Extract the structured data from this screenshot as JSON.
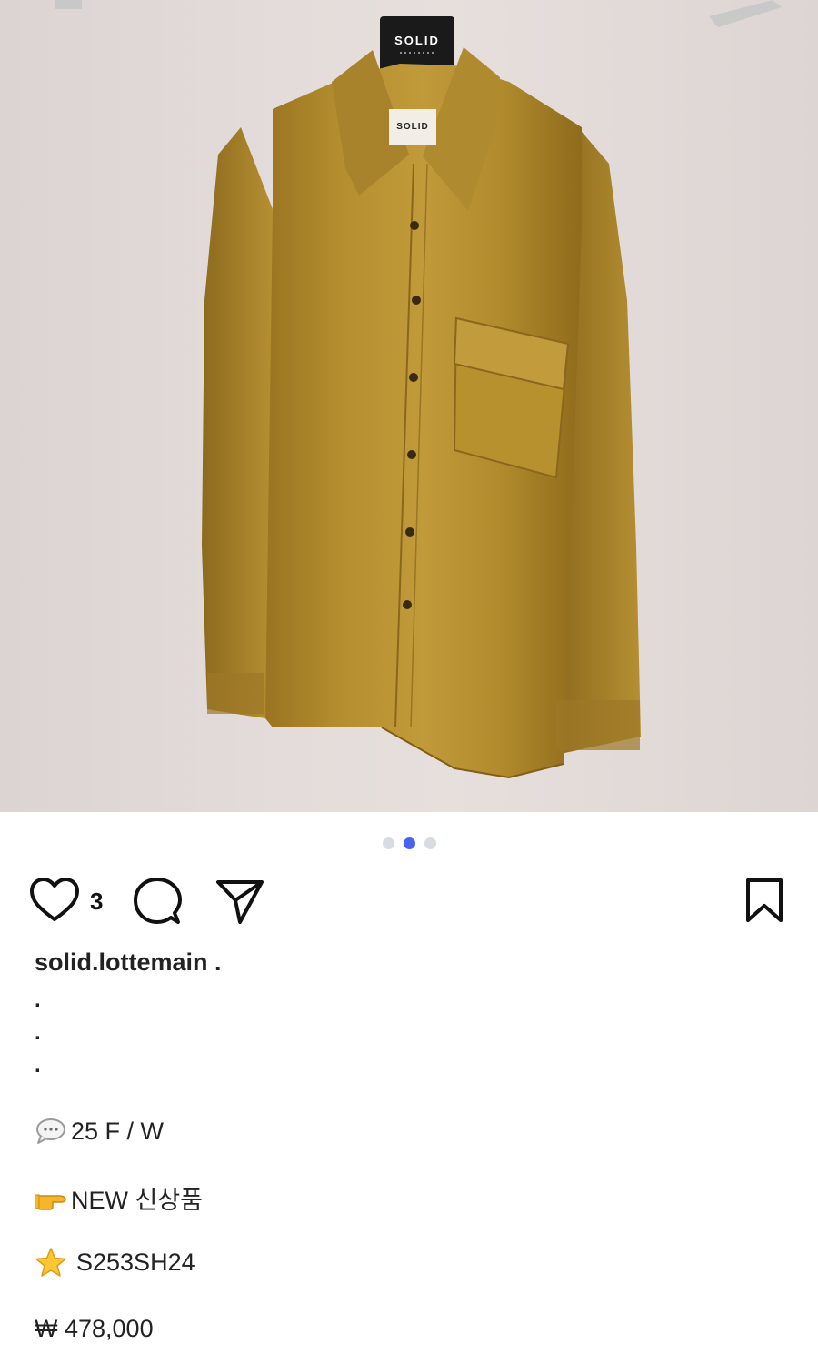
{
  "post": {
    "image": {
      "hanger_brand": "SOLID",
      "label_brand": "SOLID",
      "carousel_total": 3,
      "carousel_active_index": 1
    },
    "actions": {
      "like_count": "3"
    },
    "username": "solid.lottemain .",
    "caption": {
      "dots": [
        ".",
        ".",
        "."
      ],
      "season_emoji": "speech-bubble-icon",
      "season": "25 F / W",
      "new_emoji": "pointing-hand-icon",
      "new_label": "NEW 신상품",
      "code_emoji": "star-icon",
      "code": "S253SH24",
      "price": "₩ 478,000"
    }
  },
  "colors": {
    "accent": "#4a63ee",
    "shirt": "#b08a2c"
  }
}
